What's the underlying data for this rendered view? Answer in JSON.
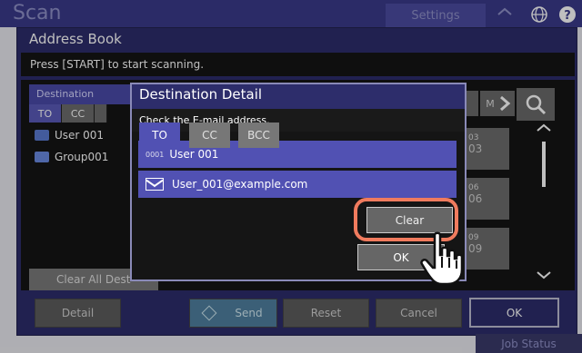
{
  "app": {
    "scan_title": "Scan",
    "settings_label": "Settings",
    "job_status_label": "Job Status"
  },
  "address_book": {
    "title": "Address Book",
    "message": "Press [START] to start scanning.",
    "destination_header": "Destination",
    "tabs": [
      "TO",
      "CC"
    ],
    "entries": [
      {
        "label": "User 001",
        "icon": "user-icon"
      },
      {
        "label": "Group001",
        "icon": "group-icon"
      }
    ],
    "clear_all_label": "Clear All Dest",
    "nav_label_m": "M",
    "cell_numbers": [
      "03",
      "03",
      "06",
      "06",
      "09",
      "09"
    ]
  },
  "bottom": {
    "detail_label": "Detail",
    "send_label": "Send",
    "reset_label": "Reset",
    "cancel_label": "Cancel",
    "ok_label": "OK"
  },
  "dialog": {
    "title": "Destination Detail",
    "message": "Check the E-mail address.",
    "user_number": "0001",
    "user_name": "User 001",
    "email": "User_001@example.com",
    "types": [
      "TO",
      "CC",
      "BCC"
    ],
    "clear_label": "Clear",
    "ok_label": "OK"
  },
  "colors": {
    "accent": "#5151b3",
    "highlight": "#f07b5e",
    "window_bg": "#2d2d6b"
  }
}
